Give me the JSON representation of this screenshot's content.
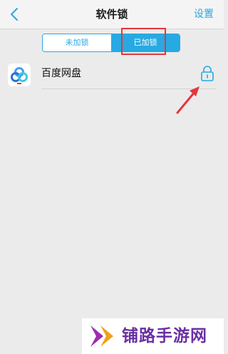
{
  "header": {
    "title": "软件锁",
    "settings_label": "设置"
  },
  "tabs": [
    {
      "label": "未加锁",
      "selected": false
    },
    {
      "label": "已加锁",
      "selected": true
    }
  ],
  "locked_apps": [
    {
      "name": "百度网盘",
      "icon": "baidu-netdisk-icon",
      "lock_icon": "lock-icon"
    }
  ],
  "annotations": {
    "highlight_color": "#e5363a",
    "arrow_color": "#e5363a"
  },
  "watermark": {
    "text": "铺路手游网"
  },
  "colors": {
    "accent": "#27a9e3",
    "background": "#ebebeb"
  }
}
